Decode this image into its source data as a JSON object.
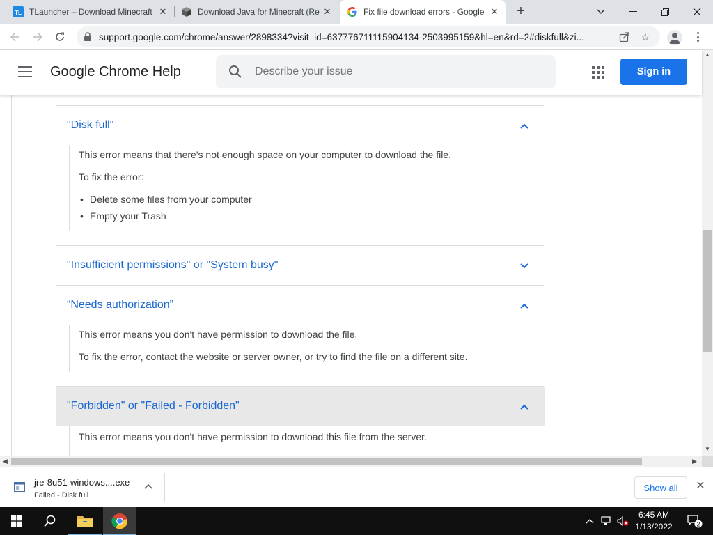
{
  "tabs": [
    {
      "title": "TLauncher – Download Minecraft",
      "favicon": "tlauncher-icon",
      "active": false
    },
    {
      "title": "Download Java for Minecraft (Re...",
      "favicon": "minecraft-block-icon",
      "active": false
    },
    {
      "title": "Fix file download errors - Google",
      "favicon": "google-g-icon",
      "active": true
    }
  ],
  "toolbar": {
    "url": "support.google.com/chrome/answer/2898334?visit_id=637776711115904134-2503995159&hl=en&rd=2#diskfull&zi..."
  },
  "header": {
    "brand": "Google Chrome Help",
    "search_placeholder": "Describe your issue",
    "sign_in": "Sign in"
  },
  "sections": [
    {
      "title": "\"Disk full\"",
      "expanded": true,
      "body": [
        "This error means that there's not enough space on your computer to download the file.",
        "To fix the error:"
      ],
      "bullets": [
        "Delete some files from your computer",
        "Empty your Trash"
      ]
    },
    {
      "title": "\"Insufficient permissions\" or \"System busy\"",
      "expanded": false
    },
    {
      "title": "“Needs authorization”",
      "expanded": true,
      "body": [
        "This error means you don't have permission to download the file.",
        "To fix the error, contact the website or server owner, or try to find the file on a different site."
      ]
    },
    {
      "title": "\"Forbidden\" or \"Failed - Forbidden\"",
      "expanded": true,
      "highlighted": true,
      "body": [
        "This error means you don't have permission to download this file from the server."
      ]
    }
  ],
  "download": {
    "filename": "jre-8u51-windows....exe",
    "status": "Failed - Disk full",
    "show_all": "Show all"
  },
  "taskbar": {
    "time": "6:45 AM",
    "date": "1/13/2022",
    "notifications": "2"
  },
  "colors": {
    "link_blue": "#1967d2",
    "sign_in_blue": "#1a73e8",
    "highlight_gray": "#e8e8e8",
    "taskbar": "#101010"
  }
}
